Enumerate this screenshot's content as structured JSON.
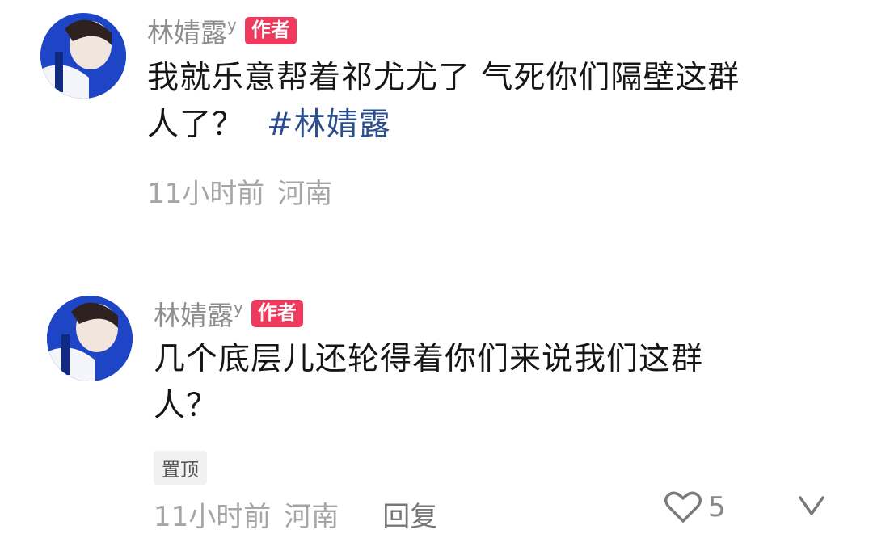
{
  "comments": [
    {
      "username": "林婧露",
      "username_suffix": "y",
      "author_badge": "作者",
      "text_line1": "我就乐意帮着祁尤尤了 气死你们隔壁这群",
      "text_line2": "人了？",
      "hashtag": "#林婧露",
      "time": "11小时前",
      "location": "河南"
    },
    {
      "username": "林婧露",
      "username_suffix": "y",
      "author_badge": "作者",
      "text_line1": "几个底层儿还轮得着你们来说我们这群",
      "text_line2": "人？",
      "pin_label": "置顶",
      "time": "11小时前",
      "location": "河南",
      "reply_label": "回复",
      "like_count": "5"
    }
  ],
  "icons": {
    "like": "heart-outline-icon",
    "dislike": "thumbs-down-icon"
  },
  "colors": {
    "author_badge": "#ef3a5d",
    "hashtag": "#2a4d8d"
  }
}
